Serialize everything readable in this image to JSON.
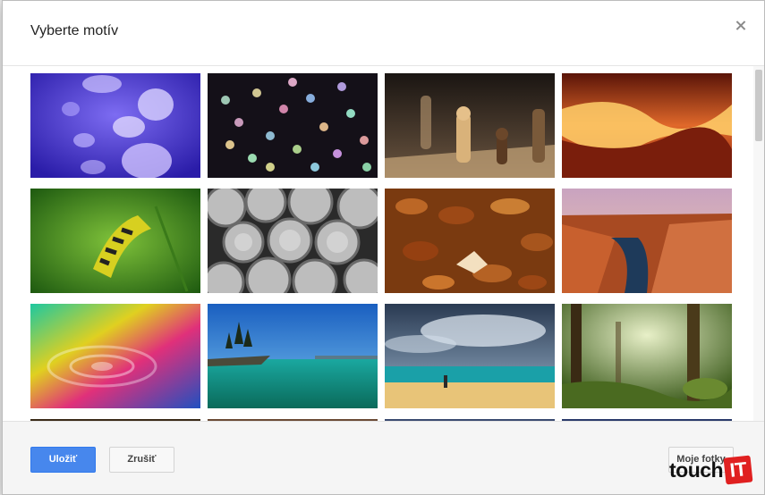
{
  "dialog": {
    "title": "Vyberte motív"
  },
  "themes": [
    {
      "name": "jellyfish",
      "label": ""
    },
    {
      "name": "bokeh-lights",
      "label": ""
    },
    {
      "name": "chess",
      "label": ""
    },
    {
      "name": "canyon-waves",
      "label": ""
    },
    {
      "name": "caterpillar",
      "label": ""
    },
    {
      "name": "pipes",
      "label": ""
    },
    {
      "name": "autumn-leaves",
      "label": ""
    },
    {
      "name": "grand-canyon",
      "label": ""
    },
    {
      "name": "rainbow-water",
      "label": ""
    },
    {
      "name": "lake-trees",
      "label": ""
    },
    {
      "name": "beach",
      "label": ""
    },
    {
      "name": "forest",
      "label": ""
    }
  ],
  "footer": {
    "save_label": "Uložiť",
    "cancel_label": "Zrušiť",
    "my_photos_label": "Moje fotky"
  },
  "watermark": {
    "text": "touch",
    "box_text": "IT"
  }
}
